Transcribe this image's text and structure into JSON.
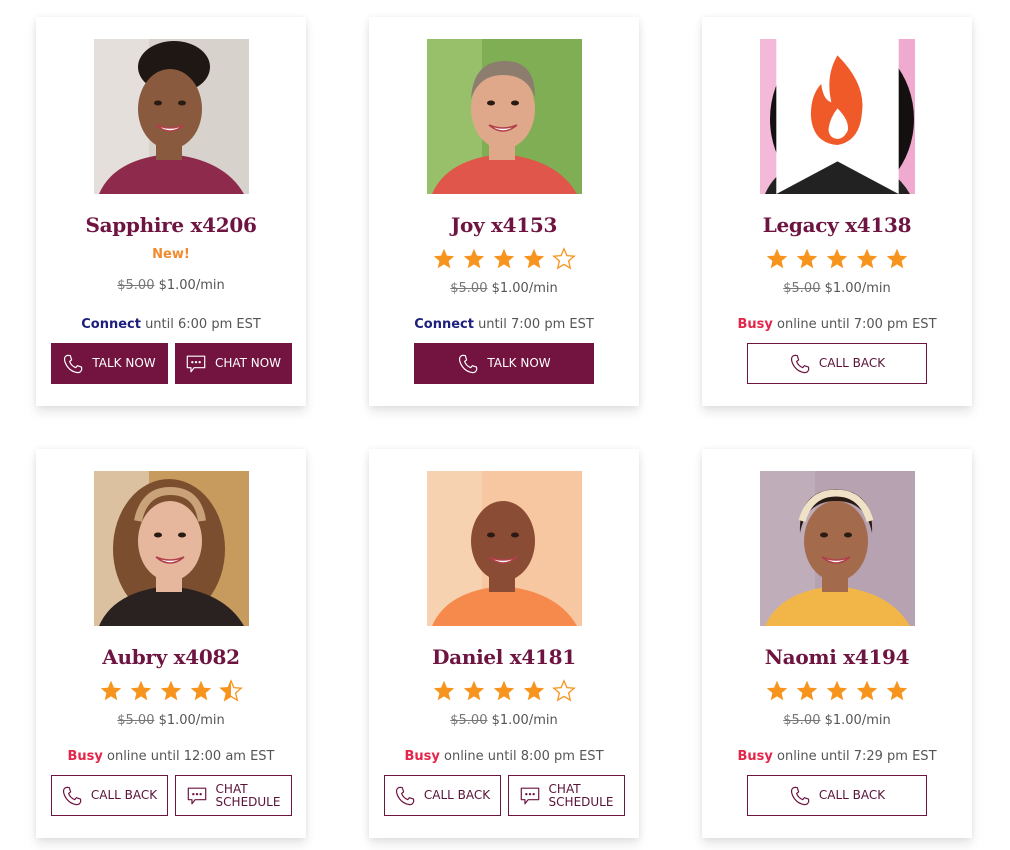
{
  "colors": {
    "brand": "#721340",
    "name": "#6e1441",
    "star": "#f7941d",
    "busy": "#e3264a",
    "connect": "#1c1f7c",
    "new": "#f28a2e"
  },
  "advisors": [
    {
      "name": "Sapphire x4206",
      "badge": "New!",
      "rating": null,
      "hot": false,
      "price_old": "$5.00",
      "price_new": "$1.00/min",
      "status_word": "Connect",
      "status_type": "connect",
      "status_text": " until 6:00 pm EST",
      "buttons": [
        {
          "label": "TALK NOW",
          "icon": "phone-icon",
          "style": "solid"
        },
        {
          "label": "CHAT NOW",
          "icon": "chat-icon",
          "style": "solid"
        }
      ]
    },
    {
      "name": "Joy x4153",
      "badge": null,
      "rating": 4,
      "hot": false,
      "price_old": "$5.00",
      "price_new": "$1.00/min",
      "status_word": "Connect",
      "status_type": "connect",
      "status_text": " until 7:00 pm EST",
      "buttons": [
        {
          "label": "TALK NOW",
          "icon": "phone-icon",
          "style": "solid"
        }
      ]
    },
    {
      "name": "Legacy x4138",
      "badge": null,
      "rating": 5,
      "hot": true,
      "price_old": "$5.00",
      "price_new": "$1.00/min",
      "status_word": "Busy",
      "status_type": "busy",
      "status_text": " online until 7:00 pm EST",
      "buttons": [
        {
          "label": "CALL BACK",
          "icon": "phone-icon",
          "style": "outline"
        }
      ]
    },
    {
      "name": "Aubry x4082",
      "badge": null,
      "rating": 4.5,
      "hot": false,
      "price_old": "$5.00",
      "price_new": "$1.00/min",
      "status_word": "Busy",
      "status_type": "busy",
      "status_text": " online until 12:00 am EST",
      "buttons": [
        {
          "label": "CALL BACK",
          "icon": "phone-icon",
          "style": "outline"
        },
        {
          "label": "CHAT SCHEDULE",
          "icon": "chat-icon",
          "style": "outline"
        }
      ]
    },
    {
      "name": "Daniel x4181",
      "badge": null,
      "rating": 4,
      "hot": false,
      "price_old": "$5.00",
      "price_new": "$1.00/min",
      "status_word": "Busy",
      "status_type": "busy",
      "status_text": " online until 8:00 pm EST",
      "buttons": [
        {
          "label": "CALL BACK",
          "icon": "phone-icon",
          "style": "outline"
        },
        {
          "label": "CHAT SCHEDULE",
          "icon": "chat-icon",
          "style": "outline"
        }
      ]
    },
    {
      "name": "Naomi x4194",
      "badge": null,
      "rating": 5,
      "hot": false,
      "price_old": "$5.00",
      "price_new": "$1.00/min",
      "status_word": "Busy",
      "status_type": "busy",
      "status_text": " online until 7:29 pm EST",
      "buttons": [
        {
          "label": "CALL BACK",
          "icon": "phone-icon",
          "style": "outline"
        }
      ]
    }
  ]
}
